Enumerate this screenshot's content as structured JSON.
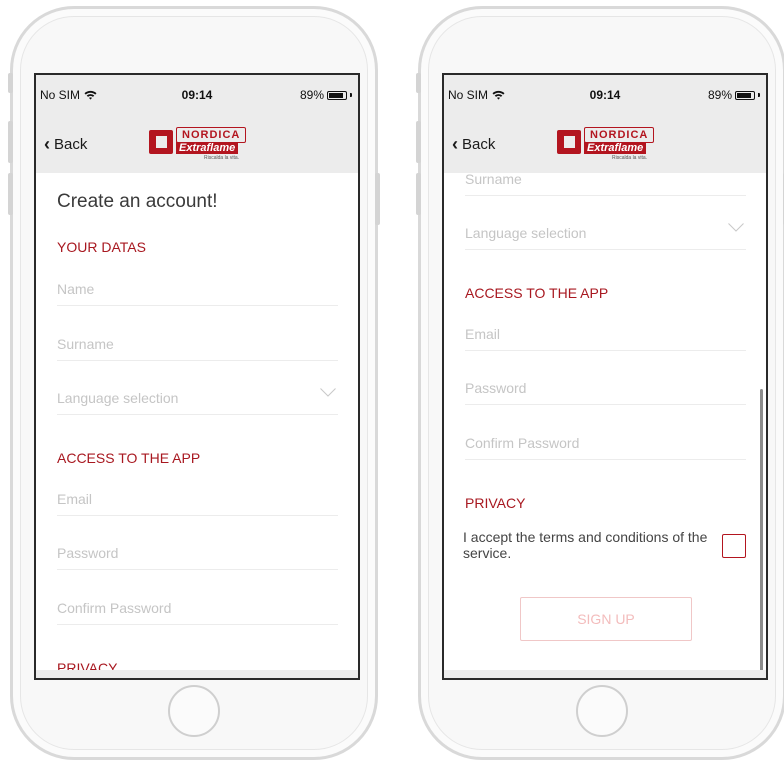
{
  "status": {
    "carrier": "No SIM",
    "time": "09:14",
    "battery_text": "89%",
    "battery_level": 0.89
  },
  "nav": {
    "back_label": "Back",
    "logo": {
      "brand": "NORDICA",
      "product": "Extraflame",
      "tagline": "Riscalda la vita."
    }
  },
  "form": {
    "title": "Create an account!",
    "section_your_datas": "YOUR DATAS",
    "name_placeholder": "Name",
    "surname_placeholder": "Surname",
    "language_placeholder": "Language selection",
    "section_access": "ACCESS TO THE APP",
    "email_placeholder": "Email",
    "password_placeholder": "Password",
    "confirm_placeholder": "Confirm Password",
    "section_privacy": "PRIVACY",
    "terms_text": "I accept the terms and conditions of the service.",
    "signup_label": "SIGN UP"
  },
  "colors": {
    "accent": "#a81820",
    "bar_background": "#ececec",
    "placeholder": "#c5c5c5",
    "signup_disabled": "#f3bcbc"
  }
}
